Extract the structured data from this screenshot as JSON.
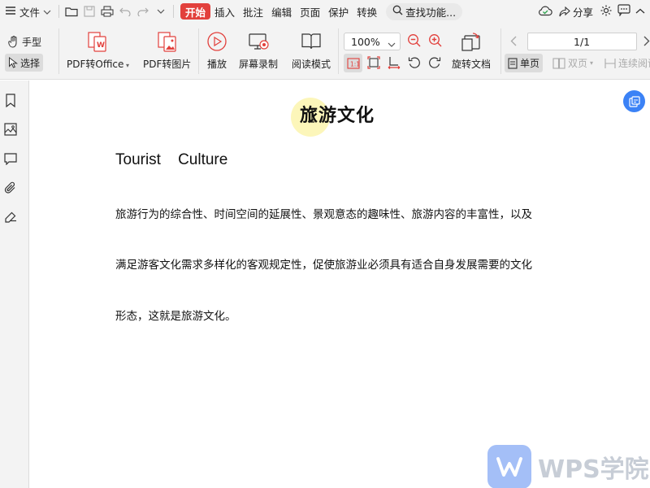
{
  "menubar": {
    "file_label": "文件",
    "tabs": [
      "开始",
      "插入",
      "批注",
      "编辑",
      "页面",
      "保护",
      "转换"
    ],
    "active_tab": "开始",
    "search_label": "查找功能...",
    "share_label": "分享"
  },
  "toolbar": {
    "hand_label": "手型",
    "select_label": "选择",
    "pdf_to_office": "PDF转Office",
    "pdf_to_image": "PDF转图片",
    "play": "播放",
    "screen_record": "屏幕录制",
    "read_mode": "阅读模式",
    "zoom": "100%",
    "rotate_doc": "旋转文档",
    "page_value": "1/1",
    "single_page": "单页",
    "double_page": "双页",
    "continuous": "连续阅读"
  },
  "document": {
    "title": "旅游文化",
    "subtitle": "Tourist    Culture",
    "paragraph_lines": [
      "旅游行为的综合性、时间空间的延展性、景观意态的趣味性、旅游内容的丰富性，以及",
      "满足游客文化需求多样化的客观规定性，促使旅游业必须具有适合自身发展需要的文化",
      "形态，这就是旅游文化。"
    ]
  },
  "watermark": {
    "text": "WPS学院"
  },
  "colors": {
    "accent": "#e2403c",
    "float_button": "#3b82f6",
    "watermark_logo": "#5b8cf2"
  }
}
